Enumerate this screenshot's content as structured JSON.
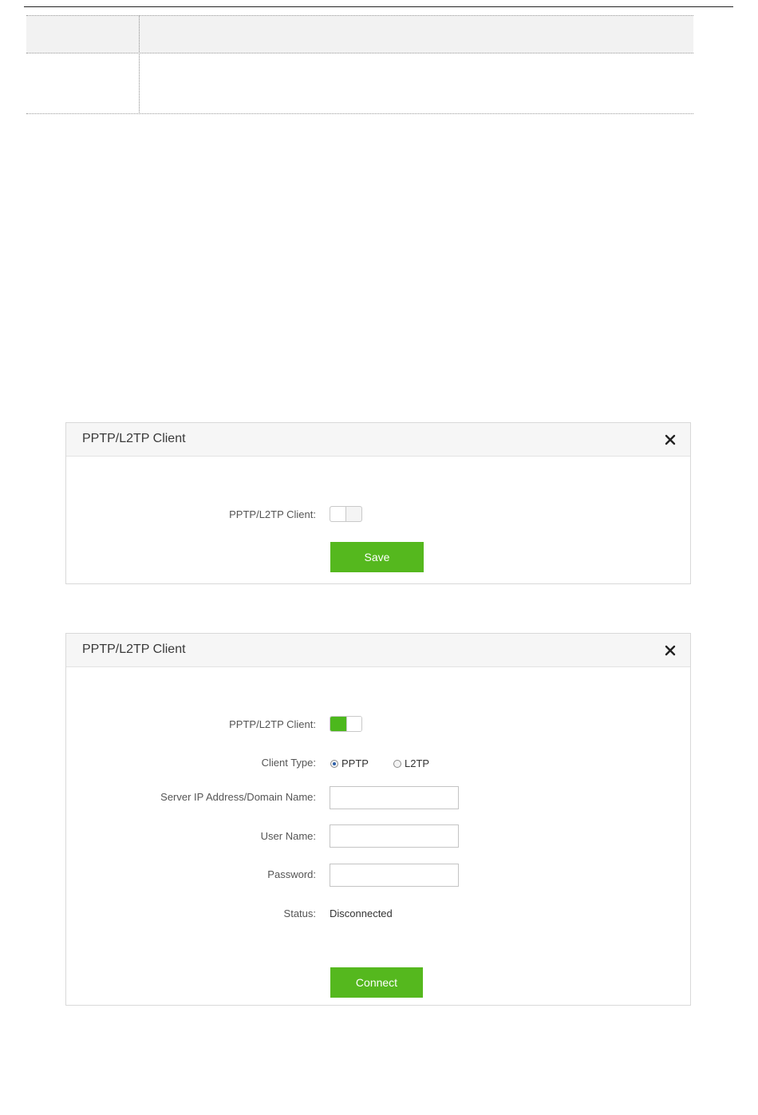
{
  "doc_table": {
    "header": {
      "col1": "",
      "col2": ""
    },
    "row": {
      "col1": "",
      "col2": ""
    }
  },
  "dialog_disabled": {
    "title": "PPTP/L2TP Client",
    "client_label": "PPTP/L2TP Client:",
    "client_enabled": false,
    "save_label": "Save"
  },
  "dialog_enabled": {
    "title": "PPTP/L2TP Client",
    "client_label": "PPTP/L2TP Client:",
    "client_enabled": true,
    "client_type_label": "Client Type:",
    "client_type_options": [
      "PPTP",
      "L2TP"
    ],
    "client_type_selected": "PPTP",
    "server_label": "Server IP Address/Domain Name:",
    "server_value": "",
    "username_label": "User Name:",
    "username_value": "",
    "password_label": "Password:",
    "password_value": "",
    "status_label": "Status:",
    "status_value": "Disconnected",
    "connect_label": "Connect"
  },
  "icons": {
    "close": "close-icon"
  },
  "colors": {
    "accent_green": "#55b81e",
    "toggle_green": "#4cb81c",
    "header_bg": "#f6f6f6",
    "border": "#d9d9d9"
  }
}
